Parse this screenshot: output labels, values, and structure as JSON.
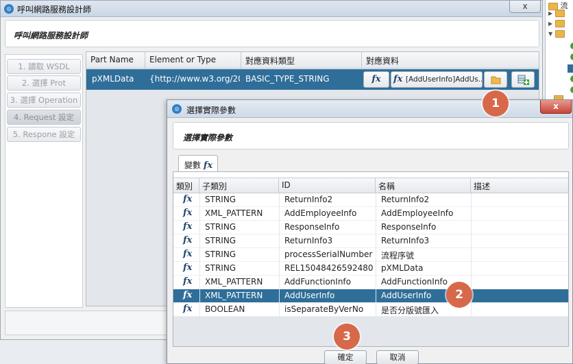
{
  "main_window": {
    "title": "呼叫網路服務設計師",
    "close_label": "x",
    "header_title": "呼叫網路服務設計師",
    "steps": [
      {
        "label": "1. 讀取 WSDL"
      },
      {
        "label": "2. 選擇 Prot"
      },
      {
        "label": "3. 選擇 Operation"
      },
      {
        "label": "4. Request 設定"
      },
      {
        "label": "5. Respone 設定"
      }
    ],
    "grid": {
      "headers": [
        "Part Name",
        "Element or Type",
        "對應資料類型",
        "對應資料"
      ],
      "row": {
        "part_name": "pXMLData",
        "element_or_type": "{http://www.w3.org/20...",
        "data_type": "BASIC_TYPE_STRING",
        "fx_label": "fx",
        "mapped_value": "[AddUserInfo]AddUs..."
      }
    }
  },
  "right_tree": {
    "top_label": "流"
  },
  "dialog": {
    "title": "選擇實際參數",
    "close_label": "x",
    "header_title": "選擇實際參數",
    "tab_label": "變數",
    "tab_icon": "fx",
    "columns": [
      "類別",
      "子類別",
      "ID",
      "名稱",
      "描述"
    ],
    "rows": [
      {
        "type": "fx",
        "subtype": "STRING",
        "id": "ReturnInfo2",
        "name": "ReturnInfo2",
        "desc": ""
      },
      {
        "type": "fx",
        "subtype": "XML_PATTERN",
        "id": "AddEmployeeInfo",
        "name": "AddEmployeeInfo",
        "desc": ""
      },
      {
        "type": "fx",
        "subtype": "STRING",
        "id": "ResponseInfo",
        "name": "ResponseInfo",
        "desc": ""
      },
      {
        "type": "fx",
        "subtype": "STRING",
        "id": "ReturnInfo3",
        "name": "ReturnInfo3",
        "desc": ""
      },
      {
        "type": "fx",
        "subtype": "STRING",
        "id": "processSerialNumber",
        "name": "流程序號",
        "desc": ""
      },
      {
        "type": "fx",
        "subtype": "STRING",
        "id": "REL15048426592480",
        "name": "pXMLData",
        "desc": ""
      },
      {
        "type": "fx",
        "subtype": "XML_PATTERN",
        "id": "AddFunctionInfo",
        "name": "AddFunctionInfo",
        "desc": ""
      },
      {
        "type": "fx",
        "subtype": "XML_PATTERN",
        "id": "AddUserInfo",
        "name": "AddUserInfo",
        "desc": ""
      },
      {
        "type": "fx",
        "subtype": "BOOLEAN",
        "id": "isSeparateByVerNo",
        "name": "是否分版號匯入",
        "desc": ""
      }
    ],
    "ok_label": "確定",
    "cancel_label": "取消"
  },
  "markers": [
    "1",
    "2",
    "3"
  ],
  "colors": {
    "selection": "#2f6e99",
    "marker": "#d8684a",
    "close_red": "#c6463a"
  }
}
